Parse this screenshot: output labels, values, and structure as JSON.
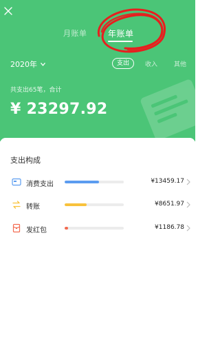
{
  "tabs": {
    "month": "月账单",
    "year": "年账单"
  },
  "year_selector": "2020年",
  "segments": {
    "expense": "支出",
    "income": "收入",
    "other": "其他"
  },
  "summary": "共支出65笔，合计",
  "total": "¥ 23297.92",
  "section_title": "支出构成",
  "categories": [
    {
      "name": "消费支出",
      "amount": "¥13459.17",
      "fraction": 0.578,
      "color": "#5b9cf0",
      "icon": "card-icon"
    },
    {
      "name": "转账",
      "amount": "¥8651.97",
      "fraction": 0.371,
      "color": "#f8c23c",
      "icon": "transfer-icon"
    },
    {
      "name": "发红包",
      "amount": "¥1186.78",
      "fraction": 0.051,
      "color": "#f36a4f",
      "icon": "red-envelope-icon"
    }
  ],
  "colors": {
    "header_green": "#4bc577",
    "annotation_red": "#e81e1e"
  }
}
